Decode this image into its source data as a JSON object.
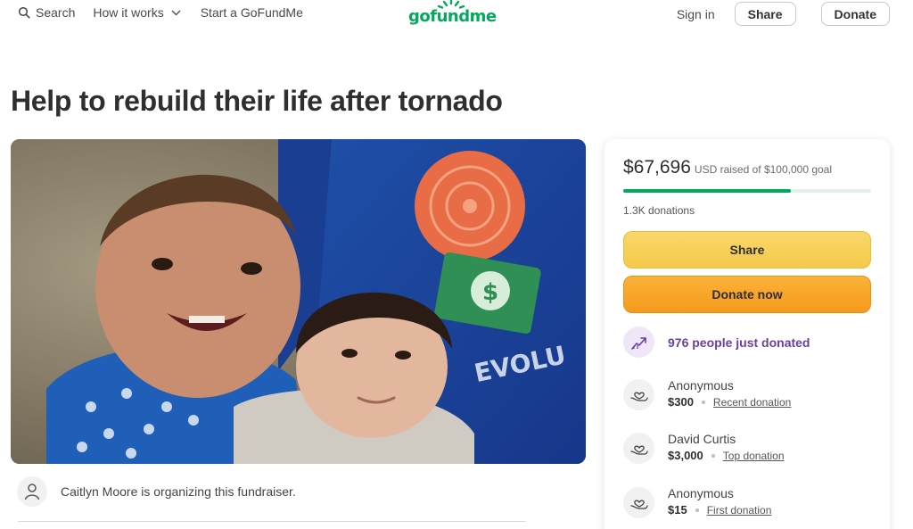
{
  "header": {
    "search_label": "Search",
    "how_it_works_label": "How it works",
    "start_label": "Start a GoFundMe",
    "logo_text": "gofundme",
    "signin_label": "Sign in",
    "share_label": "Share",
    "donate_label": "Donate",
    "brand_color": "#02a95c"
  },
  "campaign": {
    "title": "Help to rebuild their life after tornado",
    "organizer_text": "Caitlyn Moore is organizing this fundraiser."
  },
  "card": {
    "raised_amount": "$67,696",
    "raised_rest": "USD raised of $100,000 goal",
    "progress_fraction": 0.677,
    "donations_count": "1.3K donations",
    "share_label": "Share",
    "donate_now_label": "Donate now",
    "trend_text": "976 people just donated",
    "donors": [
      {
        "name": "Anonymous",
        "amount": "$300",
        "tag": "Recent donation"
      },
      {
        "name": "David Curtis",
        "amount": "$3,000",
        "tag": "Top donation"
      },
      {
        "name": "Anonymous",
        "amount": "$15",
        "tag": "First donation"
      }
    ]
  }
}
